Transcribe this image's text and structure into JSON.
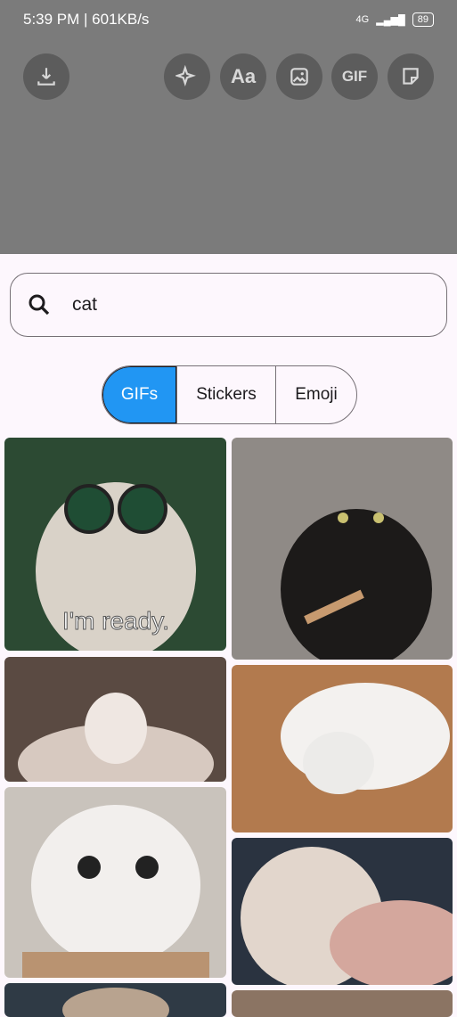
{
  "status_bar": {
    "time_speed": "5:39 PM | 601KB/s",
    "network": "4G",
    "battery": "89"
  },
  "toolbar": {
    "download_icon": "download-icon",
    "ai_icon": "sparkle-icon",
    "text_label": "Aa",
    "image_icon": "image-icon",
    "gif_label": "GIF",
    "sticker_icon": "sticker-icon"
  },
  "search": {
    "value": "cat",
    "icon": "search-icon"
  },
  "tabs": [
    {
      "label": "GIFs",
      "active": true
    },
    {
      "label": "Stickers",
      "active": false
    },
    {
      "label": "Emoji",
      "active": false
    }
  ],
  "gifs": [
    {
      "caption": "I'm ready."
    },
    {
      "caption": ""
    },
    {
      "caption": ""
    },
    {
      "caption": ""
    },
    {
      "caption": ""
    },
    {
      "caption": ""
    },
    {
      "caption": ""
    },
    {
      "caption": ""
    }
  ],
  "colors": {
    "accent": "#2196f3",
    "panel_bg": "#fdf7fd",
    "overlay": "#7b7b7b"
  }
}
